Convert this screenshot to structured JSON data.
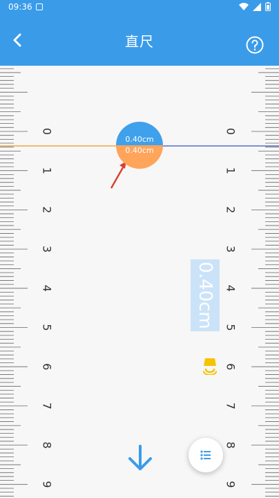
{
  "status_bar": {
    "time": "09:36"
  },
  "app_bar": {
    "title": "直尺"
  },
  "ruler": {
    "numbers": [
      "0",
      "1",
      "2",
      "3",
      "4",
      "5",
      "6",
      "7",
      "8",
      "9"
    ],
    "unit": "cm"
  },
  "bubble": {
    "top_text": "0.40cm",
    "bottom_text": "0.40cm"
  },
  "measurement_vertical": "0.40cm",
  "overlay_text": "",
  "colors": {
    "primary": "#3a9be9",
    "accent_orange": "#ffa45b",
    "bubble_blue": "#3fa0ec"
  }
}
